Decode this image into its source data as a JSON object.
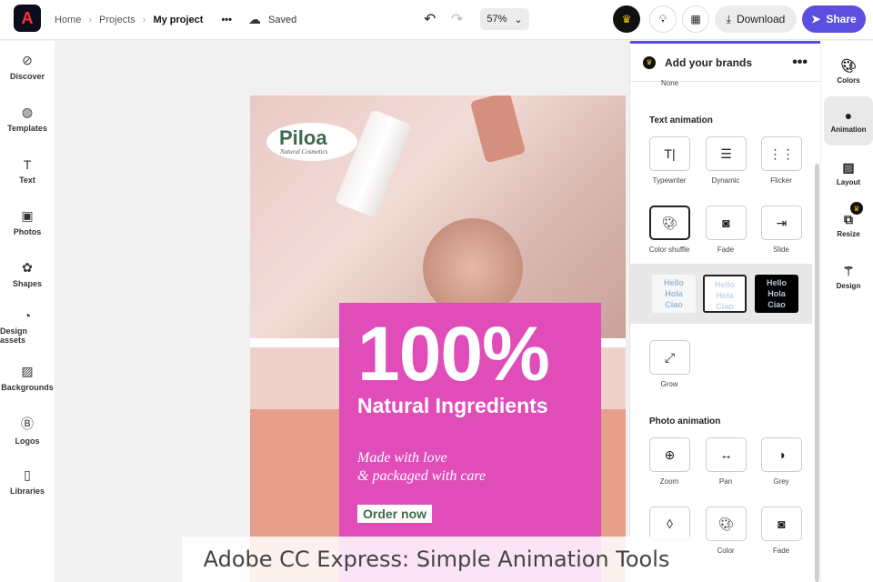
{
  "header": {
    "breadcrumbs": [
      "Home",
      "Projects"
    ],
    "current": "My project",
    "status": "Saved",
    "zoom": "57%",
    "download": "Download",
    "share": "Share"
  },
  "left_nav": [
    "Discover",
    "Templates",
    "Text",
    "Photos",
    "Shapes",
    "Design assets",
    "Backgrounds",
    "Logos",
    "Libraries"
  ],
  "poster": {
    "brand": "Piloa",
    "brand_sub": "Natural Cosmetics",
    "headline": "100%",
    "subhead": "Natural Ingredients",
    "tagline1": "Made with love",
    "tagline2": "& packaged with care",
    "cta": "Order now"
  },
  "panel": {
    "title": "Add your brands",
    "none": "None",
    "text_section": "Text animation",
    "text_items": [
      "Typewriter",
      "Dynamic",
      "Flicker",
      "Color shuffle",
      "Fade",
      "Slide",
      "Grow"
    ],
    "hello": [
      "Hello",
      "Hola",
      "Ciao"
    ],
    "photo_section": "Photo animation",
    "photo_items": [
      "Zoom",
      "Pan",
      "Grey",
      "",
      "Color",
      "Fade"
    ]
  },
  "rail": [
    "Colors",
    "Animation",
    "Layout",
    "Resize",
    "Design"
  ],
  "caption": "Adobe CC Express: Simple Animation Tools"
}
